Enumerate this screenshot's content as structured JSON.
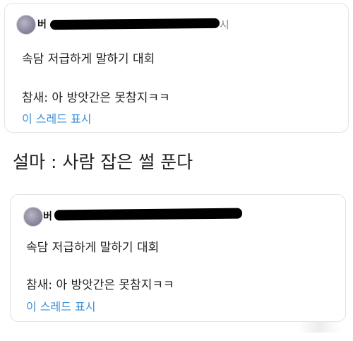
{
  "post1": {
    "author_prefix": "버",
    "author_suffix": "시",
    "text": "속담 저급하게 말하기 대회",
    "reply": "참새: 아 방앗간은 못참지ㅋㅋ",
    "thread_link": "이 스레드 표시"
  },
  "caption": "설마 : 사람 잡은 썰 푼다",
  "post2": {
    "author_prefix": "버",
    "text": "속담 저급하게 말하기 대회",
    "reply": "참새: 아 방앗간은 못참지ㅋㅋ",
    "thread_link": "이 스레드 표시"
  }
}
